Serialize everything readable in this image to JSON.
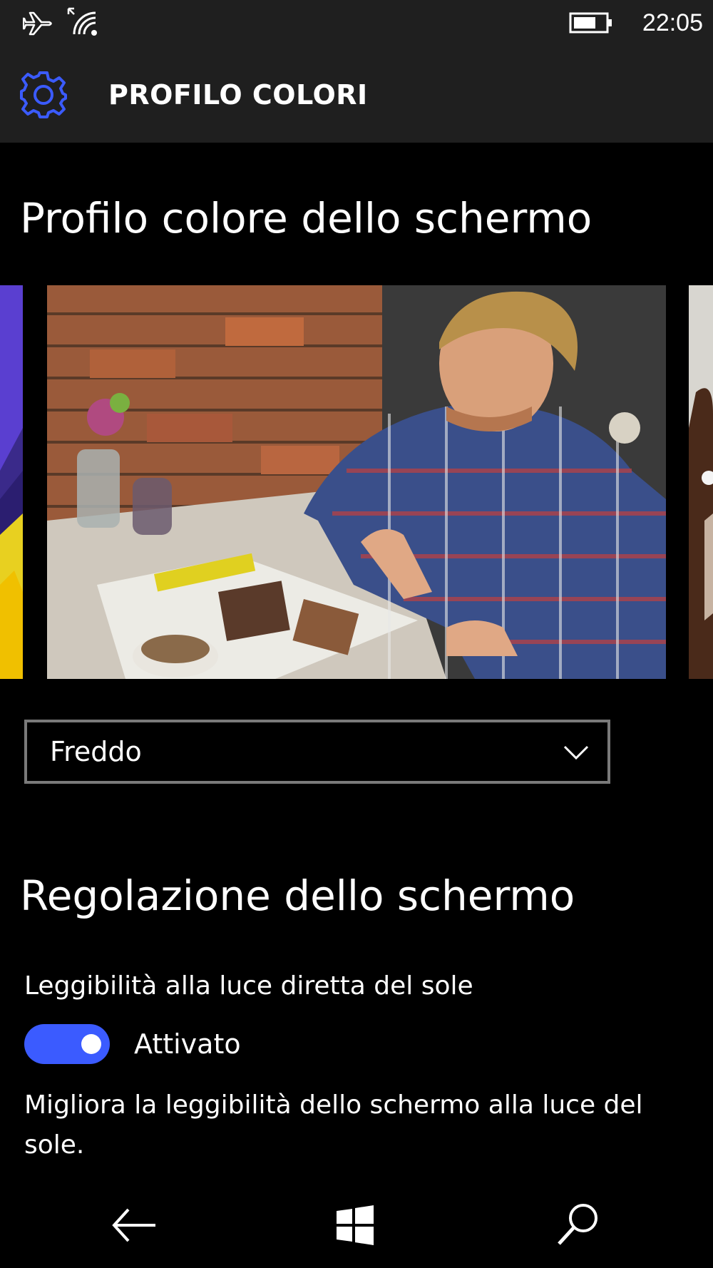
{
  "status_bar": {
    "time": "22:05",
    "icons": [
      "airplane-mode-icon",
      "wifi-icon",
      "battery-icon"
    ]
  },
  "header": {
    "title": "PROFILO COLORI",
    "icon": "gear-icon",
    "accent_color": "#3b5bff"
  },
  "color_profile": {
    "heading": "Profilo colore dello schermo",
    "dropdown": {
      "selected": "Freddo"
    }
  },
  "screen_adjustment": {
    "heading": "Regolazione dello schermo",
    "sunlight": {
      "label": "Leggibilità alla luce diretta del sole",
      "toggle_state": "Attivato",
      "toggle_on": true,
      "description": "Migliora la leggibilità dello schermo alla luce del sole."
    }
  },
  "navbar": {
    "icons": [
      "back-arrow-icon",
      "windows-logo-icon",
      "search-icon"
    ]
  }
}
